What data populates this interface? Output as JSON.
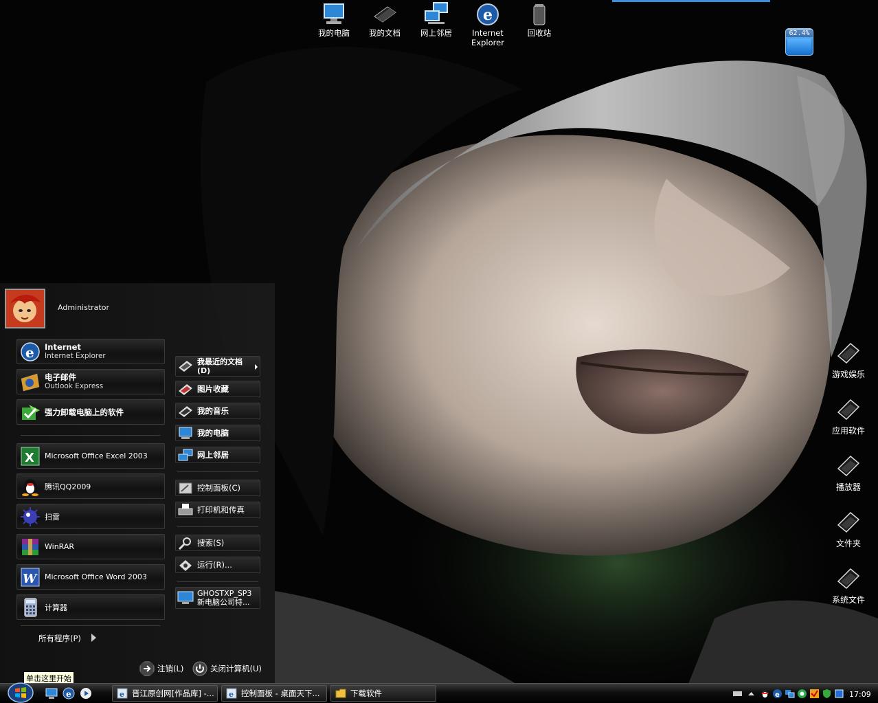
{
  "desktop_top_icons": [
    {
      "label": "我的电脑",
      "icon": "my-computer-icon"
    },
    {
      "label": "我的文档",
      "icon": "my-documents-icon"
    },
    {
      "label": "网上邻居",
      "icon": "network-places-icon"
    },
    {
      "label": "Internet\nExplorer",
      "icon": "internet-explorer-icon"
    },
    {
      "label": "回收站",
      "icon": "recycle-bin-icon"
    }
  ],
  "gauge": {
    "label": "62.4%",
    "value_percent": 62.4
  },
  "desktop_side_icons": [
    {
      "label": "游戏娱乐",
      "icon": "folder-shortcut-icon"
    },
    {
      "label": "应用软件",
      "icon": "folder-shortcut-icon"
    },
    {
      "label": "播放器",
      "icon": "folder-shortcut-icon"
    },
    {
      "label": "文件夹",
      "icon": "folder-shortcut-icon"
    },
    {
      "label": "系统文件",
      "icon": "folder-shortcut-icon"
    }
  ],
  "start_menu": {
    "user_name": "Administrator",
    "pinned": [
      {
        "title": "Internet",
        "subtitle": "Internet Explorer",
        "icon": "internet-explorer-icon"
      },
      {
        "title": "电子邮件",
        "subtitle": "Outlook Express",
        "icon": "outlook-express-icon"
      },
      {
        "title": "强力卸载电脑上的软件",
        "subtitle": "",
        "icon": "uninstaller-icon"
      }
    ],
    "recent": [
      {
        "label": "Microsoft Office Excel 2003",
        "icon": "excel-icon"
      },
      {
        "label": "腾讯QQ2009",
        "icon": "qq-icon"
      },
      {
        "label": "扫雷",
        "icon": "minesweeper-icon"
      },
      {
        "label": "WinRAR",
        "icon": "winrar-icon"
      },
      {
        "label": "Microsoft Office Word 2003",
        "icon": "word-icon"
      },
      {
        "label": "计算器",
        "icon": "calculator-icon"
      }
    ],
    "all_programs": "所有程序(P)",
    "places": [
      {
        "label": "我最近的文档\n(D)",
        "icon": "recent-documents-icon",
        "bold": true,
        "submenu": true
      },
      {
        "label": "图片收藏",
        "icon": "my-pictures-icon",
        "bold": true
      },
      {
        "label": "我的音乐",
        "icon": "my-music-icon",
        "bold": true
      },
      {
        "label": "我的电脑",
        "icon": "my-computer-icon",
        "bold": true
      },
      {
        "label": "网上邻居",
        "icon": "network-places-icon",
        "bold": true
      },
      {
        "label": "控制面板(C)",
        "icon": "control-panel-icon"
      },
      {
        "label": "打印机和传真",
        "icon": "printer-icon"
      },
      {
        "label": "搜索(S)",
        "icon": "search-icon"
      },
      {
        "label": "运行(R)...",
        "icon": "run-icon"
      },
      {
        "label": "GHOSTXP_SP3\n新电脑公司特...",
        "icon": "monitor-icon"
      }
    ],
    "log_off": "注销(L)",
    "shut_down": "关闭计算机(U)"
  },
  "tooltip": "单击这里开始",
  "taskbar": {
    "tasks": [
      {
        "label": "晋江原创网[作品库] -...",
        "icon": "ie-window-icon"
      },
      {
        "label": "控制面板 - 桌面天下...",
        "icon": "ie-window-icon"
      },
      {
        "label": "下载软件",
        "icon": "folder-window-icon"
      }
    ],
    "clock": "17:09"
  },
  "colors": {
    "taskbar": "#000000",
    "accent": "#3b8ed8",
    "tooltip_bg": "#ffffe1"
  }
}
